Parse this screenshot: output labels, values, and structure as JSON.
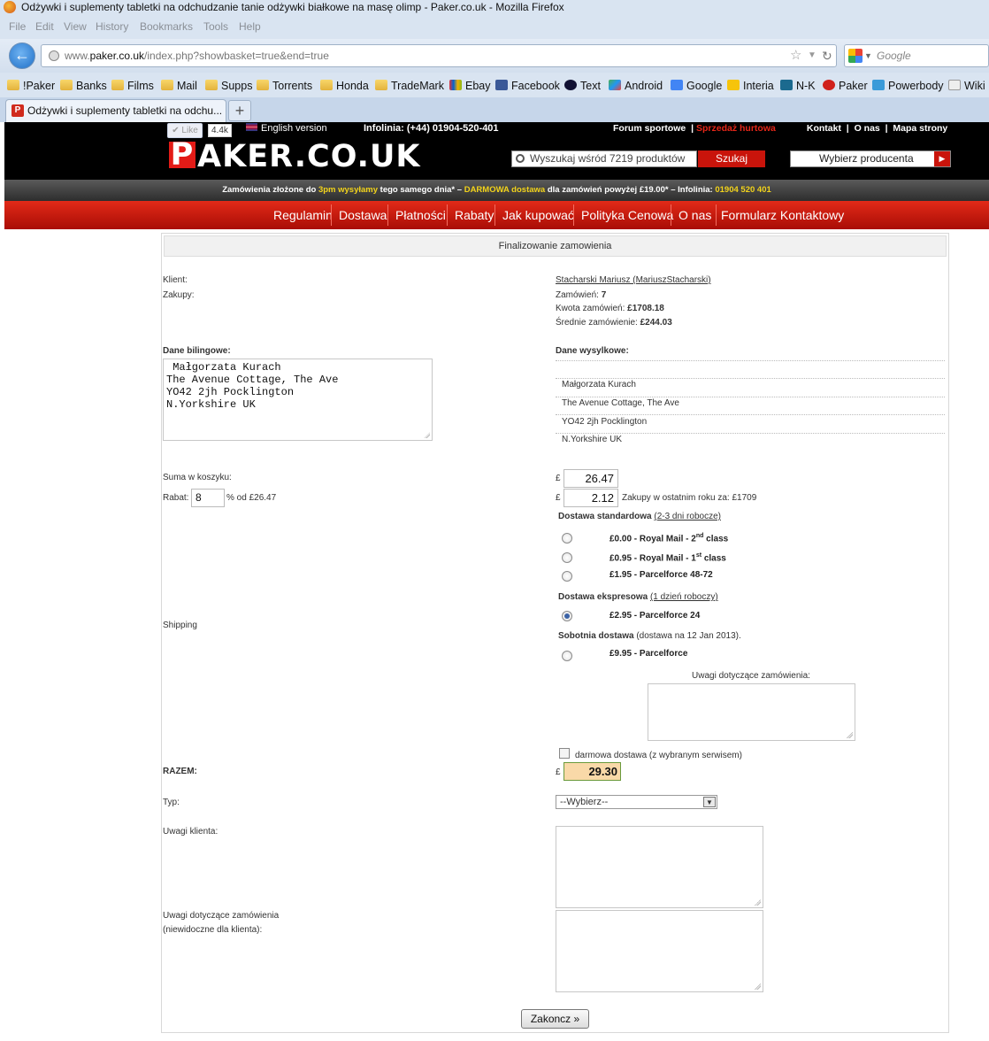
{
  "browser": {
    "window_title": "Odżywki i suplementy tabletki na odchudzanie tanie odżywki białkowe na masę olimp - Paker.co.uk - Mozilla Firefox",
    "menu": [
      "File",
      "Edit",
      "View",
      "History",
      "Bookmarks",
      "Tools",
      "Help"
    ],
    "url_prefix": "www.",
    "url_domain": "paker.co.uk",
    "url_path": "/index.php?showbasket=true&end=true",
    "search_placeholder": "Google",
    "bookmarks": [
      "!Paker",
      "Banks",
      "Films",
      "Mail",
      "Supps",
      "Torrents",
      "Honda",
      "TradeMark",
      "Ebay",
      "Facebook",
      "Text",
      "Android",
      "Google",
      "Interia",
      "N-K",
      "Paker",
      "Powerbody",
      "Wiki"
    ],
    "tab_title": "Odżywki i suplementy tabletki na odchu...",
    "new_tab_label": "+"
  },
  "site_header": {
    "like_label": "Like",
    "like_count": "4.4k",
    "english_version": "English version",
    "infolinia": "Infolinia: (+44) 01904-520-401",
    "forum": "Forum sportowe",
    "wholesale": "Sprzedaż hurtowa",
    "kontakt": "Kontakt",
    "o_nas": "O nas",
    "mapa": "Mapa strony",
    "logo_p": "P",
    "logo_rest": "AKER.CO.UK",
    "search_placeholder": "Wyszukaj wśród 7219 produktów",
    "search_button": "Szukaj",
    "producer_select": "Wybierz producenta"
  },
  "promo": {
    "part1": "Zamówienia złożone do",
    "hl1": "3pm wysyłamy",
    "part2": "tego samego dnia*  –",
    "hl2": "DARMOWA dostawa",
    "part3": "dla zamówień powyżej £19.00*  –  Infolinia:",
    "hl3": "01904 520 401"
  },
  "nav": [
    "Regulamin",
    "Dostawa",
    "Płatności",
    "Rabaty",
    "Jak kupować",
    "Polityka Cenowa",
    "O nas",
    "Formularz Kontaktowy"
  ],
  "checkout": {
    "title": "Finalizowanie zamowienia",
    "klient_label": "Klient:",
    "zakupy_label": "Zakupy:",
    "client_name": "Stacharski Mariusz (MariuszStacharski)",
    "orders_label": "Zamówień:",
    "orders_value": "7",
    "amount_label": "Kwota zamówień:",
    "amount_value": "£1708.18",
    "avg_label": "Średnie zamówienie:",
    "avg_value": "£244.03",
    "billing_label": "Dane bilingowe:",
    "billing_text": " Małgorzata Kurach\nThe Avenue Cottage, The Ave\nYO42 2jh Pocklington\nN.Yorkshire UK",
    "shipping_label": "Dane wysylkowe:",
    "shipping_lines": [
      "Małgorzata Kurach",
      "The Avenue Cottage, The Ave",
      "YO42 2jh Pocklington",
      "N.Yorkshire UK"
    ],
    "sum_label": "Suma w koszyku:",
    "rabat_label": "Rabat:",
    "rabat_value": "8",
    "rabat_suffix": "% od £26.47",
    "currency": "£",
    "sum_value": "26.47",
    "discount_value": "2.12",
    "year_note": "Zakupy w ostatnim roku za: £1709",
    "standard_title": "Dostawa standardowa",
    "standard_note": "(2-3 dni robocze)",
    "opt1_a": "£0.00 - Royal Mail - 2",
    "opt1_sup": "nd",
    "opt1_b": " class",
    "opt2_a": "£0.95 - Royal Mail - 1",
    "opt2_sup": "st",
    "opt2_b": " class",
    "opt3": "£1.95 - Parcelforce 48-72",
    "express_title": "Dostawa ekspresowa",
    "express_note": "(1 dzień roboczy)",
    "opt4": "£2.95 - Parcelforce 24",
    "shipping_row_label": "Shipping",
    "saturday_title": "Sobotnia dostawa",
    "saturday_note": "(dostawa na 12 Jan 2013).",
    "opt5": "£9.95 - Parcelforce",
    "order_notes_label": "Uwagi dotyczące zamówienia:",
    "free_delivery": "darmowa dostawa (z wybranym serwisem)",
    "razem_label": "RAZEM:",
    "razem_value": "29.30",
    "typ_label": "Typ:",
    "typ_value": "--Wybierz--",
    "client_notes_label": "Uwagi klienta:",
    "internal_notes_label1": "Uwagi dotyczące zamówienia",
    "internal_notes_label2": "(niewidoczne dla klienta):",
    "finish_button": "Zakoncz »"
  }
}
